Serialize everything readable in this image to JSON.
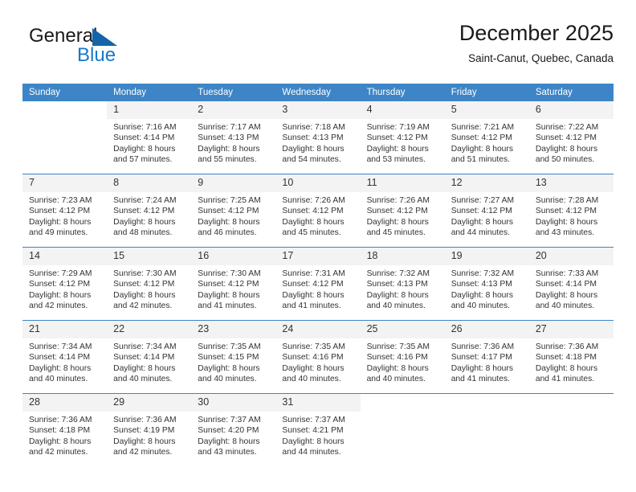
{
  "logo": {
    "part1": "General",
    "part2": "Blue",
    "triangle_color": "#1464aa",
    "blue_color": "#1878c8"
  },
  "header": {
    "title": "December 2025",
    "subtitle": "Saint-Canut, Quebec, Canada"
  },
  "theme": {
    "header_blue": "#3d85c6",
    "daynum_bg": "#f3f3f3",
    "text": "#333333"
  },
  "weekday_headers": [
    "Sunday",
    "Monday",
    "Tuesday",
    "Wednesday",
    "Thursday",
    "Friday",
    "Saturday"
  ],
  "weeks": [
    [
      {
        "day": "",
        "sunrise": "",
        "sunset": "",
        "daylight1": "",
        "daylight2": ""
      },
      {
        "day": "1",
        "sunrise": "Sunrise: 7:16 AM",
        "sunset": "Sunset: 4:14 PM",
        "daylight1": "Daylight: 8 hours",
        "daylight2": "and 57 minutes."
      },
      {
        "day": "2",
        "sunrise": "Sunrise: 7:17 AM",
        "sunset": "Sunset: 4:13 PM",
        "daylight1": "Daylight: 8 hours",
        "daylight2": "and 55 minutes."
      },
      {
        "day": "3",
        "sunrise": "Sunrise: 7:18 AM",
        "sunset": "Sunset: 4:13 PM",
        "daylight1": "Daylight: 8 hours",
        "daylight2": "and 54 minutes."
      },
      {
        "day": "4",
        "sunrise": "Sunrise: 7:19 AM",
        "sunset": "Sunset: 4:12 PM",
        "daylight1": "Daylight: 8 hours",
        "daylight2": "and 53 minutes."
      },
      {
        "day": "5",
        "sunrise": "Sunrise: 7:21 AM",
        "sunset": "Sunset: 4:12 PM",
        "daylight1": "Daylight: 8 hours",
        "daylight2": "and 51 minutes."
      },
      {
        "day": "6",
        "sunrise": "Sunrise: 7:22 AM",
        "sunset": "Sunset: 4:12 PM",
        "daylight1": "Daylight: 8 hours",
        "daylight2": "and 50 minutes."
      }
    ],
    [
      {
        "day": "7",
        "sunrise": "Sunrise: 7:23 AM",
        "sunset": "Sunset: 4:12 PM",
        "daylight1": "Daylight: 8 hours",
        "daylight2": "and 49 minutes."
      },
      {
        "day": "8",
        "sunrise": "Sunrise: 7:24 AM",
        "sunset": "Sunset: 4:12 PM",
        "daylight1": "Daylight: 8 hours",
        "daylight2": "and 48 minutes."
      },
      {
        "day": "9",
        "sunrise": "Sunrise: 7:25 AM",
        "sunset": "Sunset: 4:12 PM",
        "daylight1": "Daylight: 8 hours",
        "daylight2": "and 46 minutes."
      },
      {
        "day": "10",
        "sunrise": "Sunrise: 7:26 AM",
        "sunset": "Sunset: 4:12 PM",
        "daylight1": "Daylight: 8 hours",
        "daylight2": "and 45 minutes."
      },
      {
        "day": "11",
        "sunrise": "Sunrise: 7:26 AM",
        "sunset": "Sunset: 4:12 PM",
        "daylight1": "Daylight: 8 hours",
        "daylight2": "and 45 minutes."
      },
      {
        "day": "12",
        "sunrise": "Sunrise: 7:27 AM",
        "sunset": "Sunset: 4:12 PM",
        "daylight1": "Daylight: 8 hours",
        "daylight2": "and 44 minutes."
      },
      {
        "day": "13",
        "sunrise": "Sunrise: 7:28 AM",
        "sunset": "Sunset: 4:12 PM",
        "daylight1": "Daylight: 8 hours",
        "daylight2": "and 43 minutes."
      }
    ],
    [
      {
        "day": "14",
        "sunrise": "Sunrise: 7:29 AM",
        "sunset": "Sunset: 4:12 PM",
        "daylight1": "Daylight: 8 hours",
        "daylight2": "and 42 minutes."
      },
      {
        "day": "15",
        "sunrise": "Sunrise: 7:30 AM",
        "sunset": "Sunset: 4:12 PM",
        "daylight1": "Daylight: 8 hours",
        "daylight2": "and 42 minutes."
      },
      {
        "day": "16",
        "sunrise": "Sunrise: 7:30 AM",
        "sunset": "Sunset: 4:12 PM",
        "daylight1": "Daylight: 8 hours",
        "daylight2": "and 41 minutes."
      },
      {
        "day": "17",
        "sunrise": "Sunrise: 7:31 AM",
        "sunset": "Sunset: 4:12 PM",
        "daylight1": "Daylight: 8 hours",
        "daylight2": "and 41 minutes."
      },
      {
        "day": "18",
        "sunrise": "Sunrise: 7:32 AM",
        "sunset": "Sunset: 4:13 PM",
        "daylight1": "Daylight: 8 hours",
        "daylight2": "and 40 minutes."
      },
      {
        "day": "19",
        "sunrise": "Sunrise: 7:32 AM",
        "sunset": "Sunset: 4:13 PM",
        "daylight1": "Daylight: 8 hours",
        "daylight2": "and 40 minutes."
      },
      {
        "day": "20",
        "sunrise": "Sunrise: 7:33 AM",
        "sunset": "Sunset: 4:14 PM",
        "daylight1": "Daylight: 8 hours",
        "daylight2": "and 40 minutes."
      }
    ],
    [
      {
        "day": "21",
        "sunrise": "Sunrise: 7:34 AM",
        "sunset": "Sunset: 4:14 PM",
        "daylight1": "Daylight: 8 hours",
        "daylight2": "and 40 minutes."
      },
      {
        "day": "22",
        "sunrise": "Sunrise: 7:34 AM",
        "sunset": "Sunset: 4:14 PM",
        "daylight1": "Daylight: 8 hours",
        "daylight2": "and 40 minutes."
      },
      {
        "day": "23",
        "sunrise": "Sunrise: 7:35 AM",
        "sunset": "Sunset: 4:15 PM",
        "daylight1": "Daylight: 8 hours",
        "daylight2": "and 40 minutes."
      },
      {
        "day": "24",
        "sunrise": "Sunrise: 7:35 AM",
        "sunset": "Sunset: 4:16 PM",
        "daylight1": "Daylight: 8 hours",
        "daylight2": "and 40 minutes."
      },
      {
        "day": "25",
        "sunrise": "Sunrise: 7:35 AM",
        "sunset": "Sunset: 4:16 PM",
        "daylight1": "Daylight: 8 hours",
        "daylight2": "and 40 minutes."
      },
      {
        "day": "26",
        "sunrise": "Sunrise: 7:36 AM",
        "sunset": "Sunset: 4:17 PM",
        "daylight1": "Daylight: 8 hours",
        "daylight2": "and 41 minutes."
      },
      {
        "day": "27",
        "sunrise": "Sunrise: 7:36 AM",
        "sunset": "Sunset: 4:18 PM",
        "daylight1": "Daylight: 8 hours",
        "daylight2": "and 41 minutes."
      }
    ],
    [
      {
        "day": "28",
        "sunrise": "Sunrise: 7:36 AM",
        "sunset": "Sunset: 4:18 PM",
        "daylight1": "Daylight: 8 hours",
        "daylight2": "and 42 minutes."
      },
      {
        "day": "29",
        "sunrise": "Sunrise: 7:36 AM",
        "sunset": "Sunset: 4:19 PM",
        "daylight1": "Daylight: 8 hours",
        "daylight2": "and 42 minutes."
      },
      {
        "day": "30",
        "sunrise": "Sunrise: 7:37 AM",
        "sunset": "Sunset: 4:20 PM",
        "daylight1": "Daylight: 8 hours",
        "daylight2": "and 43 minutes."
      },
      {
        "day": "31",
        "sunrise": "Sunrise: 7:37 AM",
        "sunset": "Sunset: 4:21 PM",
        "daylight1": "Daylight: 8 hours",
        "daylight2": "and 44 minutes."
      },
      {
        "day": "",
        "sunrise": "",
        "sunset": "",
        "daylight1": "",
        "daylight2": ""
      },
      {
        "day": "",
        "sunrise": "",
        "sunset": "",
        "daylight1": "",
        "daylight2": ""
      },
      {
        "day": "",
        "sunrise": "",
        "sunset": "",
        "daylight1": "",
        "daylight2": ""
      }
    ]
  ]
}
